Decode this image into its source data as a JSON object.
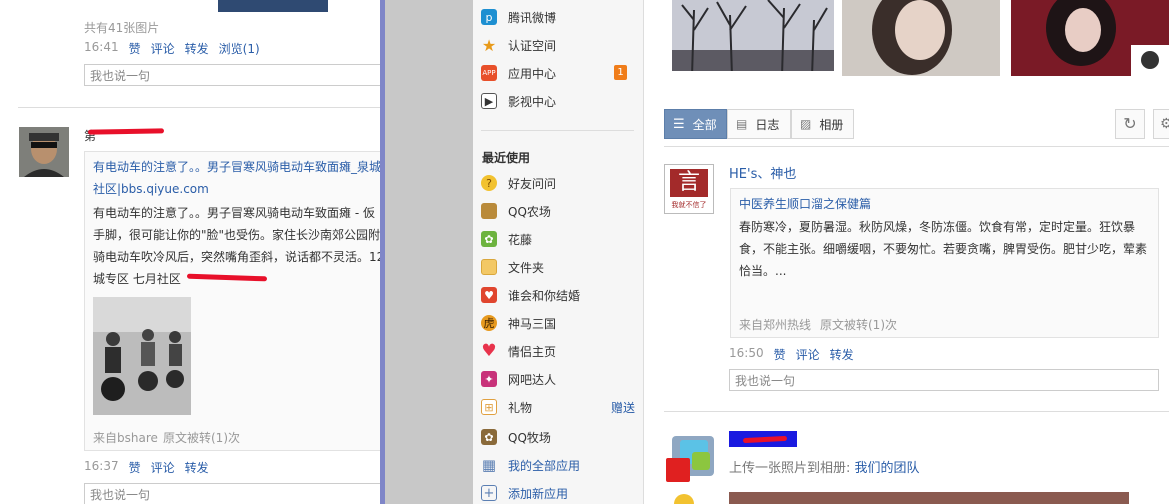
{
  "left_feed": {
    "post1": {
      "photo_count": "共有41张图片",
      "time": "16:41",
      "actions": [
        "赞",
        "评论",
        "转发",
        "浏览(1)"
      ],
      "comment_placeholder": "我也说一句"
    },
    "post2": {
      "name_visible_char": "第",
      "share_title": "有电动车的注意了。。男子冒寒风骑电动车致面瘫_泉城",
      "share_source": "社区|bbs.qiyue.com",
      "share_text": "有电动车的注意了。。男子冒寒风骑电动车致面瘫 - 仮",
      "share_text2": "手脚，很可能让你的\"脸\"也受伤。家住长沙南郊公园附",
      "share_text3": "骑电动车吹冷风后，突然嘴角歪斜，说话都不灵活。12",
      "share_text4": "城专区 七月社区",
      "from": "来自bshare",
      "repost": "原文被转(1)次",
      "time": "16:37",
      "actions": [
        "赞",
        "评论",
        "转发"
      ],
      "comment_placeholder": "我也说一句"
    }
  },
  "app_menu": {
    "top_items": [
      {
        "label": "腾讯微博",
        "icon": "tencent-weibo-icon"
      },
      {
        "label": "认证空间",
        "icon": "star-icon"
      },
      {
        "label": "应用中心",
        "icon": "app-center-icon",
        "badge": "1"
      },
      {
        "label": "影视中心",
        "icon": "film-icon"
      }
    ],
    "recent_heading": "最近使用",
    "recent_items": [
      {
        "label": "好友问问",
        "icon": "question-face-icon"
      },
      {
        "label": "QQ农场",
        "icon": "farm-box-icon"
      },
      {
        "label": "花藤",
        "icon": "flower-vine-icon"
      },
      {
        "label": "文件夹",
        "icon": "folder-icon"
      },
      {
        "label": "谁会和你结婚",
        "icon": "heart-box-icon"
      },
      {
        "label": "神马三国",
        "icon": "tiger-icon"
      },
      {
        "label": "情侣主页",
        "icon": "heart-icon"
      },
      {
        "label": "网吧达人",
        "icon": "gift-bag-icon"
      },
      {
        "label": "礼物",
        "icon": "present-icon",
        "extra": "赠送"
      },
      {
        "label": "QQ牧场",
        "icon": "ranch-icon"
      },
      {
        "label": "我的全部应用",
        "icon": "grid-icon"
      },
      {
        "label": "添加新应用",
        "icon": "plus-icon"
      }
    ]
  },
  "right_feed": {
    "tabs": [
      {
        "label": "全部",
        "active": true
      },
      {
        "label": "日志",
        "active": false
      },
      {
        "label": "相册",
        "active": false
      }
    ],
    "post1": {
      "author": "HE's、神也",
      "avatar_text": "言",
      "avatar_caption": "我就不信了",
      "share_title": "中医养生顺口溜之保健篇",
      "share_text": "春防寒冷，夏防暑湿。秋防风燥，冬防冻僵。饮食有常，定时定量。狂饮暴",
      "share_text2": "食，不能主张。细嚼缓咽，不要匆忙。若要贪嘴，脾胃受伤。肥甘少吃，荤素",
      "share_text3": "恰当。...",
      "from": "来自郑州热线",
      "repost": "原文被转(1)次",
      "time": "16:50",
      "actions": [
        "赞",
        "评论",
        "转发"
      ],
      "comment_placeholder": "我也说一句"
    },
    "post2": {
      "upload_text": "上传一张照片到相册:",
      "album_link": "我们的团队"
    }
  },
  "colors": {
    "link": "#2a5da8",
    "divider": "#7f86c8",
    "tab_active": "#6f8fb8",
    "badge": "#f07d1a",
    "redaction": "#e8102a"
  }
}
